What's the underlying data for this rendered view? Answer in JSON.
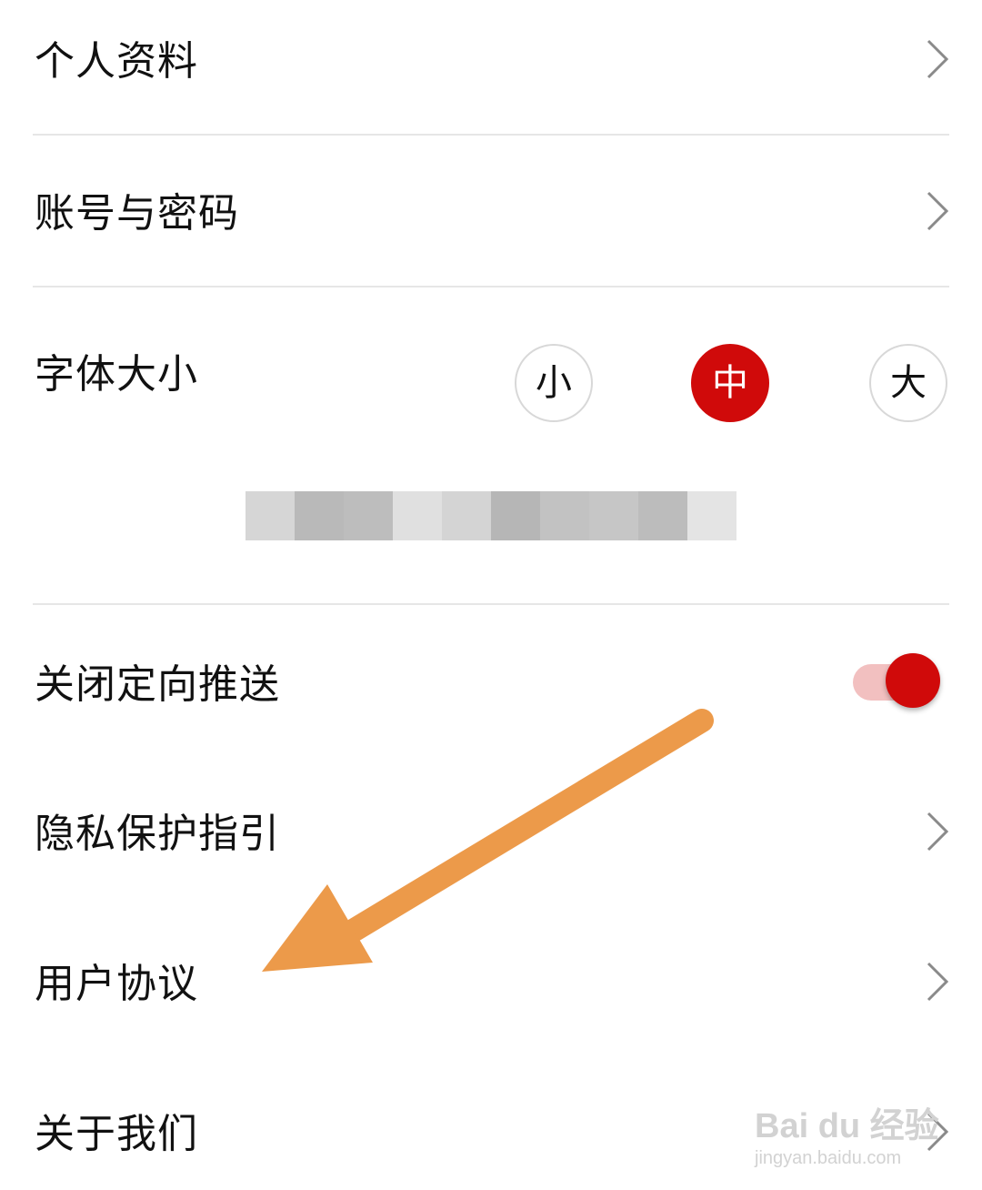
{
  "settings": {
    "items": [
      {
        "label": "个人资料"
      },
      {
        "label": "账号与密码"
      },
      {
        "label": "字体大小"
      },
      {
        "label": "关闭定向推送"
      },
      {
        "label": "隐私保护指引"
      },
      {
        "label": "用户协议"
      },
      {
        "label": "关于我们"
      }
    ],
    "font_size": {
      "options": [
        "小",
        "中",
        "大"
      ],
      "selected": "中"
    },
    "targeted_push": {
      "enabled": true
    }
  },
  "colors": {
    "accent": "#d00a0a",
    "toggle_track": "#f2c0c0",
    "divider": "#e6e6e6",
    "annotation_arrow": "#ec9a4a"
  },
  "icons": {
    "chevron": "chevron-right-icon"
  },
  "watermark": {
    "brand": "Bai du 经验",
    "url": "jingyan.baidu.com"
  }
}
